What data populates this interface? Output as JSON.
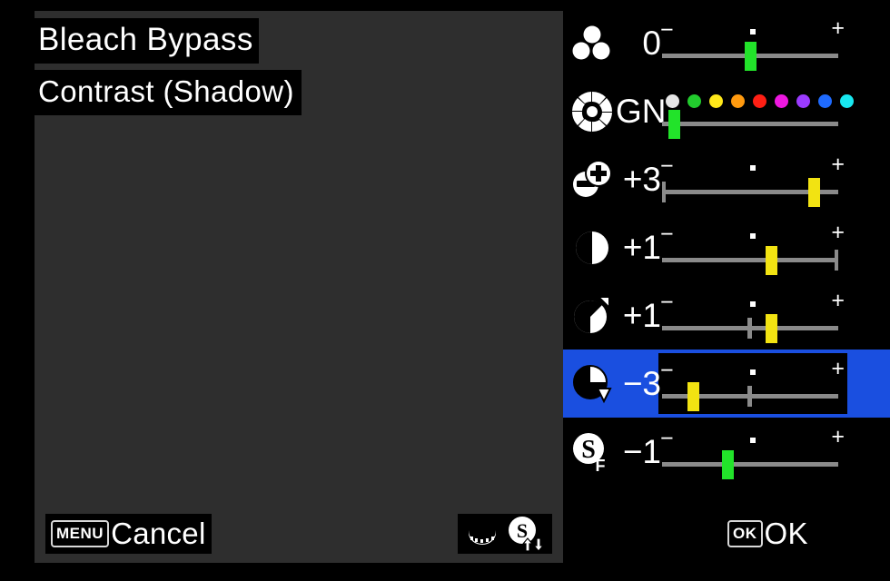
{
  "screen": {
    "background_color": "#000000",
    "panel_color": "#2e2e2e",
    "accent_selected_color": "#1a4fe0",
    "thumb_green": "#22e32a",
    "thumb_yellow": "#f2e312",
    "track_color": "#8a8a8a"
  },
  "header": {
    "title": "Bleach Bypass",
    "subtitle": "Contrast (Shadow)"
  },
  "slider_panel": {
    "minus_mark": "−",
    "plus_mark": "+",
    "rows": [
      {
        "name": "grain-effect",
        "icon": "three-dots-grain-icon",
        "value": "0",
        "thumb_color": "#22e32a",
        "thumb_percent": 50,
        "cap": "none",
        "center_tick": false,
        "selected": false,
        "has_swatches": false
      },
      {
        "name": "grain-color",
        "icon": "segmented-ring-icon",
        "value": "GN",
        "thumb_color": "#22e32a",
        "thumb_percent": 6,
        "cap": "none",
        "center_tick": false,
        "selected": false,
        "has_swatches": true,
        "swatches": [
          "#e6e6e6",
          "#22cc2e",
          "#ffe81a",
          "#ff9a0f",
          "#ff1f14",
          "#ee18e0",
          "#9b3bff",
          "#1f6bff",
          "#18e8f0"
        ],
        "hide_marks": true
      },
      {
        "name": "sharpness",
        "icon": "plus-minus-circles-icon",
        "value": "+3",
        "thumb_color": "#f2e312",
        "thumb_percent": 87,
        "cap": "left",
        "center_tick": false,
        "selected": false,
        "has_swatches": false
      },
      {
        "name": "contrast",
        "icon": "half-circle-icon",
        "value": "+1",
        "thumb_color": "#f2e312",
        "thumb_percent": 62,
        "cap": "right",
        "center_tick": false,
        "selected": false,
        "has_swatches": false
      },
      {
        "name": "contrast-highlight",
        "icon": "pie-up-arrow-icon",
        "value": "+1",
        "thumb_color": "#f2e312",
        "thumb_percent": 62,
        "cap": "none",
        "center_tick": true,
        "selected": false,
        "has_swatches": false
      },
      {
        "name": "contrast-shadow",
        "icon": "pie-down-arrow-icon",
        "value": "−3",
        "thumb_color": "#f2e312",
        "thumb_percent": 17,
        "cap": "none",
        "center_tick": true,
        "selected": true,
        "has_swatches": false
      },
      {
        "name": "saturation-fine",
        "icon": "s-subscript-f-icon",
        "value": "−1",
        "thumb_color": "#22e32a",
        "thumb_percent": 37,
        "cap": "none",
        "center_tick": false,
        "selected": false,
        "has_swatches": false
      }
    ]
  },
  "footer": {
    "cancel": {
      "badge": "MENU",
      "label": "Cancel"
    },
    "ok": {
      "badge": "OK",
      "label": "OK"
    },
    "dial_hint": {
      "dial_icon": "dial-wheel-icon",
      "mode_icon": "s-circle-swap-icon"
    }
  }
}
